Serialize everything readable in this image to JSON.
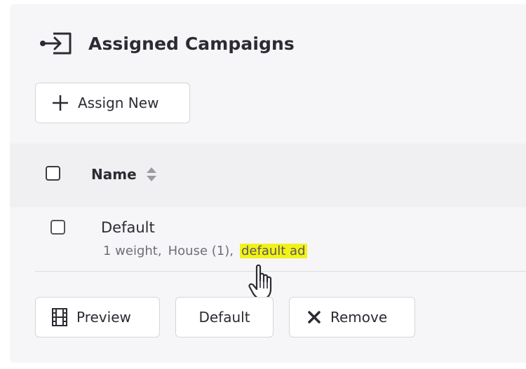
{
  "section": {
    "title": "Assigned Campaigns",
    "icon": "sign-in-icon"
  },
  "toolbar": {
    "assign_label": "Assign New",
    "assign_icon": "plus-icon"
  },
  "table": {
    "columns": [
      {
        "label": "Name",
        "sortable": true
      }
    ],
    "rows": [
      {
        "title": "Default",
        "meta": [
          "1 weight",
          "House (1)",
          "default ad"
        ],
        "highlighted_meta": "default ad",
        "highlight_color": "#f2f21a"
      }
    ]
  },
  "actions": {
    "preview_label": "Preview",
    "preview_icon": "film-icon",
    "default_label": "Default",
    "remove_label": "Remove",
    "remove_icon": "x-icon"
  },
  "colors": {
    "panel_bg": "#f6f6f8",
    "header_bg": "#f0f0f3",
    "text": "#2b2b33",
    "muted_text": "#6e6e78"
  }
}
